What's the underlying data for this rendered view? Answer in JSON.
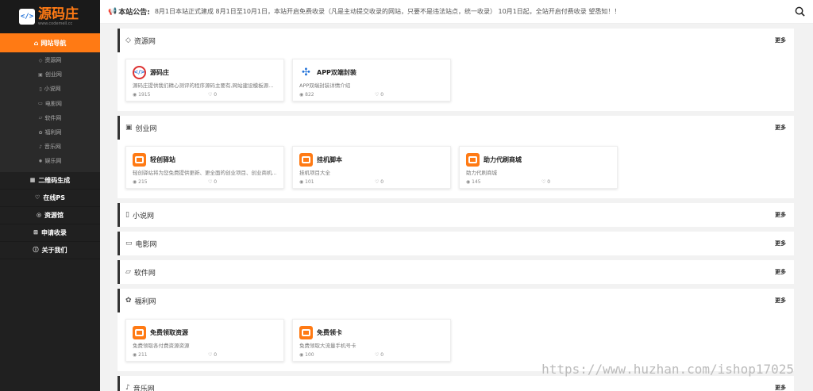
{
  "logo": {
    "title": "源码庄",
    "subtitle": "www.codemell.cc",
    "mark": "</>"
  },
  "sidebar": {
    "head_label": "网站导航",
    "sub_items": [
      {
        "label": "资源网",
        "icon": "diamond-icon"
      },
      {
        "label": "创业网",
        "icon": "briefcase-icon"
      },
      {
        "label": "小说网",
        "icon": "file-icon"
      },
      {
        "label": "电影网",
        "icon": "monitor-icon"
      },
      {
        "label": "软件网",
        "icon": "folder-icon"
      },
      {
        "label": "福利网",
        "icon": "gift-icon"
      },
      {
        "label": "音乐网",
        "icon": "music-icon"
      },
      {
        "label": "娱乐网",
        "icon": "gear-icon"
      }
    ],
    "main_items": [
      {
        "label": "二维码生成",
        "icon": "qrcode-icon"
      },
      {
        "label": "在线PS",
        "icon": "heart-icon"
      },
      {
        "label": "资源馆",
        "icon": "target-icon"
      },
      {
        "label": "申请收录",
        "icon": "plus-square-icon"
      },
      {
        "label": "关于我们",
        "icon": "info-icon"
      }
    ]
  },
  "notice": {
    "label": "本站公告:",
    "text": "8月1日本站正式建成 8月1日至10月1日，本站开启免费收录（凡是主动提交收录的网站，只要不是违法站点，统一收录） 10月1日起，全站开启付费收录 望悉知！！"
  },
  "sections": [
    {
      "title": "资源网",
      "icon": "diamond-icon",
      "more": "更多",
      "cards": [
        {
          "title": "源码庄",
          "desc": "源码庄提供我们精心测评的程序源码主要有,网站建设模板源码,...",
          "views": "1915",
          "likes": "0",
          "icon": "blue"
        },
        {
          "title": "APP双端封装",
          "desc": "APP双端封装详情介绍",
          "views": "822",
          "likes": "0",
          "icon": "app"
        }
      ]
    },
    {
      "title": "创业网",
      "icon": "briefcase-icon",
      "more": "更多",
      "cards": [
        {
          "title": "轻创驿站",
          "desc": "轻创驿站将为您免费提供更新、更全面的创业项目、创业商机...",
          "views": "215",
          "likes": "0",
          "icon": "orange"
        },
        {
          "title": "挂机脚本",
          "desc": "挂机项目大全",
          "views": "101",
          "likes": "0",
          "icon": "orange"
        },
        {
          "title": "助力代刷商城",
          "desc": "助力代刷商城",
          "views": "145",
          "likes": "0",
          "icon": "orange"
        }
      ]
    },
    {
      "title": "小说网",
      "icon": "file-icon",
      "more": "更多",
      "cards": []
    },
    {
      "title": "电影网",
      "icon": "monitor-icon",
      "more": "更多",
      "cards": []
    },
    {
      "title": "软件网",
      "icon": "folder-icon",
      "more": "更多",
      "cards": []
    },
    {
      "title": "福利网",
      "icon": "gift-icon",
      "more": "更多",
      "cards": [
        {
          "title": "免费领取资源",
          "desc": "免费领取各付费资源资源",
          "views": "211",
          "likes": "0",
          "icon": "orange"
        },
        {
          "title": "免费领卡",
          "desc": "免费领取大流量手机号卡",
          "views": "100",
          "likes": "0",
          "icon": "orange"
        }
      ]
    },
    {
      "title": "音乐网",
      "icon": "music-icon",
      "more": "更多",
      "cards": []
    }
  ],
  "watermark": "https://www.huzhan.com/ishop17025"
}
